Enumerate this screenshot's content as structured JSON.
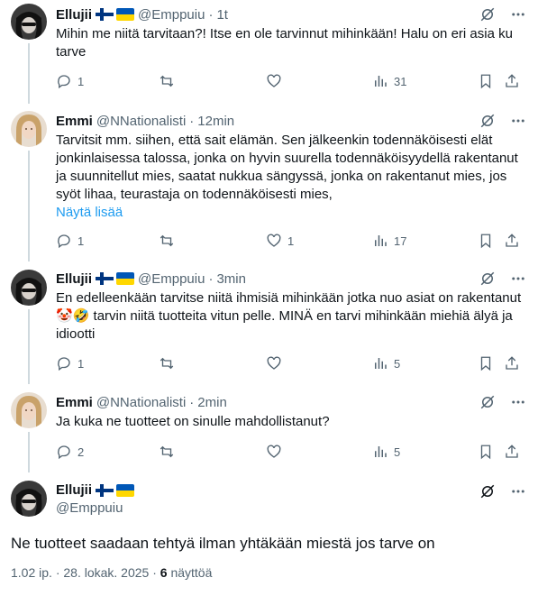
{
  "tweets": [
    {
      "name": "Ellujii",
      "handle": "@Emppuiu",
      "time": "1t",
      "text": "Mihin me niitä tarvitaan?! Itse en ole tarvinnut mihinkään! Halu on eri asia ku tarve",
      "replies": "1",
      "retweets": "",
      "likes": "",
      "views": "31"
    },
    {
      "name": "Emmi",
      "handle": "@NNationalisti",
      "time": "12min",
      "text": "Tarvitsit mm. siihen, että sait elämän. Sen jälkeenkin todennäköisesti elät jonkinlaisessa talossa, jonka on hyvin suurella todennäköisyydellä rakentanut ja suunnitellut mies, saatat nukkua sängyssä, jonka on rakentanut mies, jos syöt lihaa, teurastaja on todennäköisesti mies,",
      "show_more": "Näytä lisää",
      "replies": "1",
      "retweets": "",
      "likes": "1",
      "views": "17"
    },
    {
      "name": "Ellujii",
      "handle": "@Emppuiu",
      "time": "3min",
      "text_a": "En edelleenkään tarvitse niitä ihmisiä mihinkään jotka nuo asiat on rakentanut ",
      "emojis": "🤡🤣",
      "text_b": " tarvin niitä tuotteita vitun pelle. MINÄ en tarvi mihinkään miehiä älyä ja idiootti",
      "replies": "1",
      "retweets": "",
      "likes": "",
      "views": "5"
    },
    {
      "name": "Emmi",
      "handle": "@NNationalisti",
      "time": "2min",
      "text": "Ja kuka ne tuotteet on sinulle mahdollistanut?",
      "replies": "2",
      "retweets": "",
      "likes": "",
      "views": "5"
    }
  ],
  "main": {
    "name": "Ellujii",
    "handle": "@Emppuiu",
    "text": "Ne tuotteet saadaan tehtyä ilman yhtäkään miestä jos tarve on",
    "timestamp": "1.02 ip. · 28. lokak. 2025 · ",
    "views_count": "6",
    "views_label": " näyttöä"
  },
  "colors": {
    "finland_blue": "#003580",
    "ukraine_blue": "#0057b7",
    "ukraine_yellow": "#ffd700",
    "link": "#1d9bf0",
    "secondary": "#536471"
  },
  "icons": [
    "grok-icon",
    "more-icon",
    "reply-icon",
    "retweet-icon",
    "like-icon",
    "views-icon",
    "bookmark-icon",
    "share-icon"
  ]
}
